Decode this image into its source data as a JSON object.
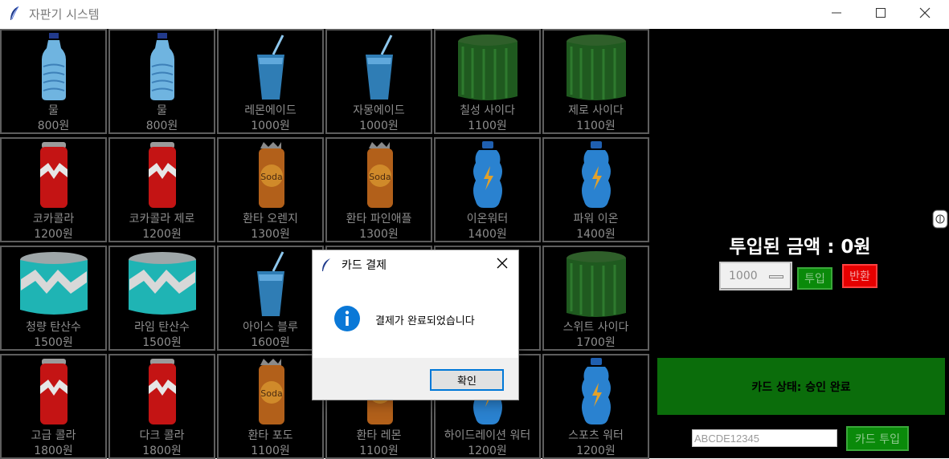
{
  "window": {
    "title": "자판기 시스템",
    "icon": "feather-icon",
    "controls": [
      "minimize-icon",
      "maximize-icon",
      "close-icon"
    ]
  },
  "products": [
    {
      "name": "물",
      "price": "800원",
      "icon": "water-bottle"
    },
    {
      "name": "물",
      "price": "800원",
      "icon": "water-bottle"
    },
    {
      "name": "레몬에이드",
      "price": "1000원",
      "icon": "cup-with-straw"
    },
    {
      "name": "자몽에이드",
      "price": "1000원",
      "icon": "cup-with-straw"
    },
    {
      "name": "칠성 사이다",
      "price": "1100원",
      "icon": "green-can"
    },
    {
      "name": "제로 사이다",
      "price": "1100원",
      "icon": "green-can"
    },
    {
      "name": "코카콜라",
      "price": "1200원",
      "icon": "red-can"
    },
    {
      "name": "코카콜라 제로",
      "price": "1200원",
      "icon": "red-can"
    },
    {
      "name": "환타 오렌지",
      "price": "1300원",
      "icon": "soda-can"
    },
    {
      "name": "환타 파인애플",
      "price": "1300원",
      "icon": "soda-can"
    },
    {
      "name": "이온워터",
      "price": "1400원",
      "icon": "sport-bottle"
    },
    {
      "name": "파워 이온",
      "price": "1400원",
      "icon": "sport-bottle"
    },
    {
      "name": "청량 탄산수",
      "price": "1500원",
      "icon": "teal-can"
    },
    {
      "name": "라임 탄산수",
      "price": "1500원",
      "icon": "teal-can"
    },
    {
      "name": "아이스 블루",
      "price": "1600원",
      "icon": "cup-with-straw"
    },
    {
      "name": "",
      "price": "",
      "icon": "hidden"
    },
    {
      "name": "",
      "price": "",
      "icon": "hidden"
    },
    {
      "name": "스위트 사이다",
      "price": "1700원",
      "icon": "green-can"
    },
    {
      "name": "고급 콜라",
      "price": "1800원",
      "icon": "red-can"
    },
    {
      "name": "다크 콜라",
      "price": "1800원",
      "icon": "red-can"
    },
    {
      "name": "환타 포도",
      "price": "1100원",
      "icon": "soda-can"
    },
    {
      "name": "환타 레몬",
      "price": "1100원",
      "icon": "soda-can"
    },
    {
      "name": "하이드레이션 워터",
      "price": "1200원",
      "icon": "sport-bottle"
    },
    {
      "name": "스포츠 워터",
      "price": "1200원",
      "icon": "sport-bottle"
    }
  ],
  "panel": {
    "amount_label": "투입된 금액 :  0원",
    "bill_select_value": "1000",
    "insert_button": "투입",
    "return_button": "반환",
    "card_status": "카드 상태: 승인 완료",
    "card_number_value": "ABCDE12345",
    "card_insert_button": "카드 투입"
  },
  "dialog": {
    "title": "카드 결제",
    "message": "결제가 완료되었습니다",
    "ok_button": "확인",
    "icon": "info-icon"
  },
  "colors": {
    "background": "#000000",
    "cell_border": "#5e5e5e",
    "button_green": "#0a8a0a",
    "button_red": "#e60000",
    "card_status_bg": "#0b6d0b",
    "info_blue": "#0078d7"
  }
}
